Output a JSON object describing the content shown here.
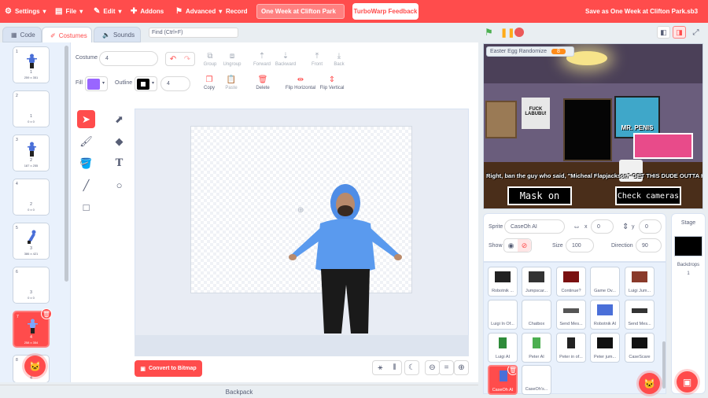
{
  "menubar": {
    "settings": "Settings",
    "file": "File",
    "edit": "Edit",
    "addons": "Addons",
    "advanced": "Advanced",
    "record": "Record",
    "project_title": "One Week at Clifton Park",
    "feedback": "TurboWarp Feedback",
    "save_as": "Save as One Week at Clifton Park.sb3"
  },
  "tabs": {
    "code": "Code",
    "costumes": "Costumes",
    "sounds": "Sounds"
  },
  "find": {
    "placeholder": "Find (Ctrl+F)"
  },
  "costumes": [
    {
      "num": "1",
      "name": "1",
      "dim": "259 x 351"
    },
    {
      "num": "2",
      "name": "1",
      "dim": "0 x 0"
    },
    {
      "num": "3",
      "name": "2",
      "dim": "187 x 255"
    },
    {
      "num": "4",
      "name": "2",
      "dim": "0 x 0"
    },
    {
      "num": "5",
      "name": "3",
      "dim": "386 x 421"
    },
    {
      "num": "6",
      "name": "3",
      "dim": "0 x 0"
    },
    {
      "num": "7",
      "name": "4",
      "dim": "258 x 354"
    },
    {
      "num": "8",
      "name": "4",
      "dim": ""
    }
  ],
  "editor": {
    "costume_label": "Costume",
    "costume_value": "4",
    "fill_label": "Fill",
    "outline_label": "Outline",
    "outline_width": "4",
    "group": "Group",
    "ungroup": "Ungroup",
    "forward": "Forward",
    "backward": "Backward",
    "front": "Front",
    "back": "Back",
    "copy": "Copy",
    "paste": "Paste",
    "delete": "Delete",
    "flip_h": "Flip Horizontal",
    "flip_v": "Flip Vertical",
    "convert": "Convert to Bitmap",
    "fill_color": "#9966ff"
  },
  "backpack": "Backpack",
  "stage": {
    "monitor_label": "Easter Egg Randomize",
    "monitor_value": "8",
    "banner_text": "Right, ban the guy who said, \"Micheal Flapjackson\" GET THIS DUDE OUTTA HERE!!",
    "poster_text": "FUCK LABUBU!",
    "sign_text": "MR. PENIS",
    "mask_btn": "Mask on",
    "cameras_btn": "Check cameras"
  },
  "sprite_info": {
    "sprite_label": "Sprite",
    "sprite_name": "CaseOh AI",
    "x_label": "x",
    "x_value": "0",
    "y_label": "y",
    "y_value": "0",
    "show_label": "Show",
    "size_label": "Size",
    "size_value": "100",
    "direction_label": "Direction",
    "direction_value": "90"
  },
  "sprites": [
    {
      "name": "Robotnik ..."
    },
    {
      "name": "Jumpscar..."
    },
    {
      "name": "Continue?"
    },
    {
      "name": "Game Ov..."
    },
    {
      "name": "Luigi Jum..."
    },
    {
      "name": "Luigi In Of..."
    },
    {
      "name": "Chatbox"
    },
    {
      "name": "Send Mes..."
    },
    {
      "name": "Robotnik AI"
    },
    {
      "name": "Send Mes..."
    },
    {
      "name": "Luigi AI"
    },
    {
      "name": "Peter AI"
    },
    {
      "name": "Peter in of..."
    },
    {
      "name": "Peter jum..."
    },
    {
      "name": "CaseScare"
    },
    {
      "name": "CaseOh AI"
    },
    {
      "name": "CaseOh's..."
    }
  ],
  "stage_pane": {
    "title": "Stage",
    "backdrops_label": "Backdrops",
    "backdrops_count": "1"
  }
}
